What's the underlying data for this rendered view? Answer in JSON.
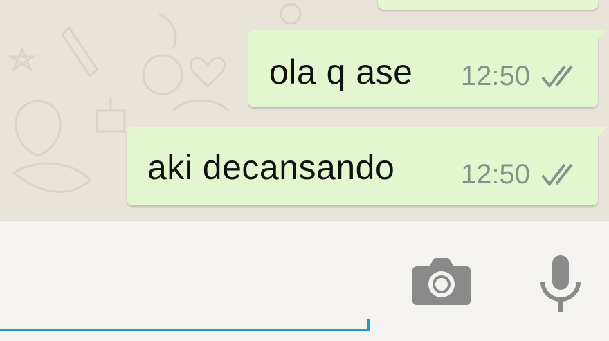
{
  "messages": [
    {
      "text": "ola q ase",
      "time": "12:50",
      "status": "read-ticks-icon"
    },
    {
      "text": "aki decansando",
      "time": "12:50",
      "status": "read-ticks-icon"
    }
  ],
  "input": {
    "value": ""
  },
  "icons": {
    "camera": "camera-icon",
    "mic": "mic-icon"
  },
  "colors": {
    "bubble": "#e3f6d0",
    "accent": "#2196d3",
    "time": "#8b8f8a",
    "icon": "#8a8a8a"
  }
}
